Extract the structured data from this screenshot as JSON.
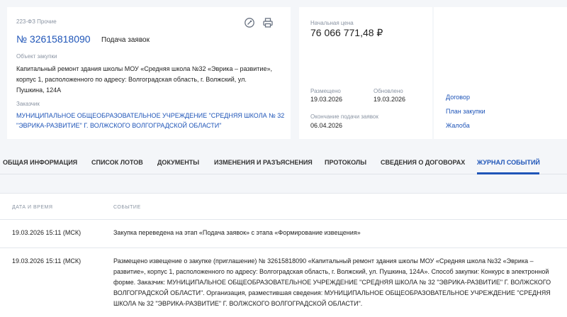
{
  "summary": {
    "law_type": "223-ФЗ Прочие",
    "reg_number": "№ 32615818090",
    "stage": "Подача заявок",
    "object_label": "Объект закупки",
    "object_text": "Капитальный ремонт здания школы МОУ «Средняя школа №32 «Эврика – развитие», корпус 1, расположенного по адресу: Волгоградская область, г. Волжский, ул. Пушкина, 124А",
    "customer_label": "Заказчик",
    "customer_text": "МУНИЦИПАЛЬНОЕ ОБЩЕОБРАЗОВАТЕЛЬНОЕ УЧРЕЖДЕНИЕ \"СРЕДНЯЯ ШКОЛА № 32 \"ЭВРИКА-РАЗВИТИЕ\" Г. ВОЛЖСКОГО ВОЛГОГРАДСКОЙ ОБЛАСТИ\""
  },
  "icons": {
    "seal": "seal-icon",
    "print": "print-icon"
  },
  "price": {
    "label": "Начальная цена",
    "value": "76 066 771,48 ₽",
    "posted_label": "Размещено",
    "posted_value": "19.03.2026",
    "updated_label": "Обновлено",
    "updated_value": "19.03.2026",
    "deadline_label": "Окончание подачи заявок",
    "deadline_value": "06.04.2026"
  },
  "side_links": [
    "Договор",
    "План закупки",
    "Жалоба"
  ],
  "tabs": [
    "ОБЩАЯ ИНФОРМАЦИЯ",
    "СПИСОК ЛОТОВ",
    "ДОКУМЕНТЫ",
    "ИЗМЕНЕНИЯ И РАЗЪЯСНЕНИЯ",
    "ПРОТОКОЛЫ",
    "СВЕДЕНИЯ О ДОГОВОРАХ",
    "ЖУРНАЛ СОБЫТИЙ"
  ],
  "active_tab": "ЖУРНАЛ СОБЫТИЙ",
  "journal": {
    "col_date": "ДАТА И ВРЕМЯ",
    "col_event": "СОБЫТИЕ",
    "rows": [
      {
        "date": "19.03.2026 15:11 (МСК)",
        "event": "Закупка переведена на этап «Подача заявок» с этапа «Формирование извещения»"
      },
      {
        "date": "19.03.2026 15:11 (МСК)",
        "event": "Размещено извещение о закупке (приглашение) № 32615818090 «Капитальный ремонт здания школы МОУ «Средняя школа №32 «Эврика – развитие», корпус 1, расположенного по адресу: Волгоградская область, г. Волжский, ул. Пушкина, 124А». Способ закупки: Конкурс в электронной форме. Заказчик: МУНИЦИПАЛЬНОЕ ОБЩЕОБРАЗОВАТЕЛЬНОЕ УЧРЕЖДЕНИЕ \"СРЕДНЯЯ ШКОЛА № 32 \"ЭВРИКА-РАЗВИТИЕ\" Г. ВОЛЖСКОГО ВОЛГОГРАДСКОЙ ОБЛАСТИ\". Организация, разместившая сведения: МУНИЦИПАЛЬНОЕ ОБЩЕОБРАЗОВАТЕЛЬНОЕ УЧРЕЖДЕНИЕ \"СРЕДНЯЯ ШКОЛА № 32 \"ЭВРИКА-РАЗВИТИЕ\" Г. ВОЛЖСКОГО ВОЛГОГРАДСКОЙ ОБЛАСТИ\"."
      }
    ]
  },
  "colors": {
    "accent": "#1f55b8",
    "background": "#f4f6f9",
    "muted": "#8a94a3"
  }
}
